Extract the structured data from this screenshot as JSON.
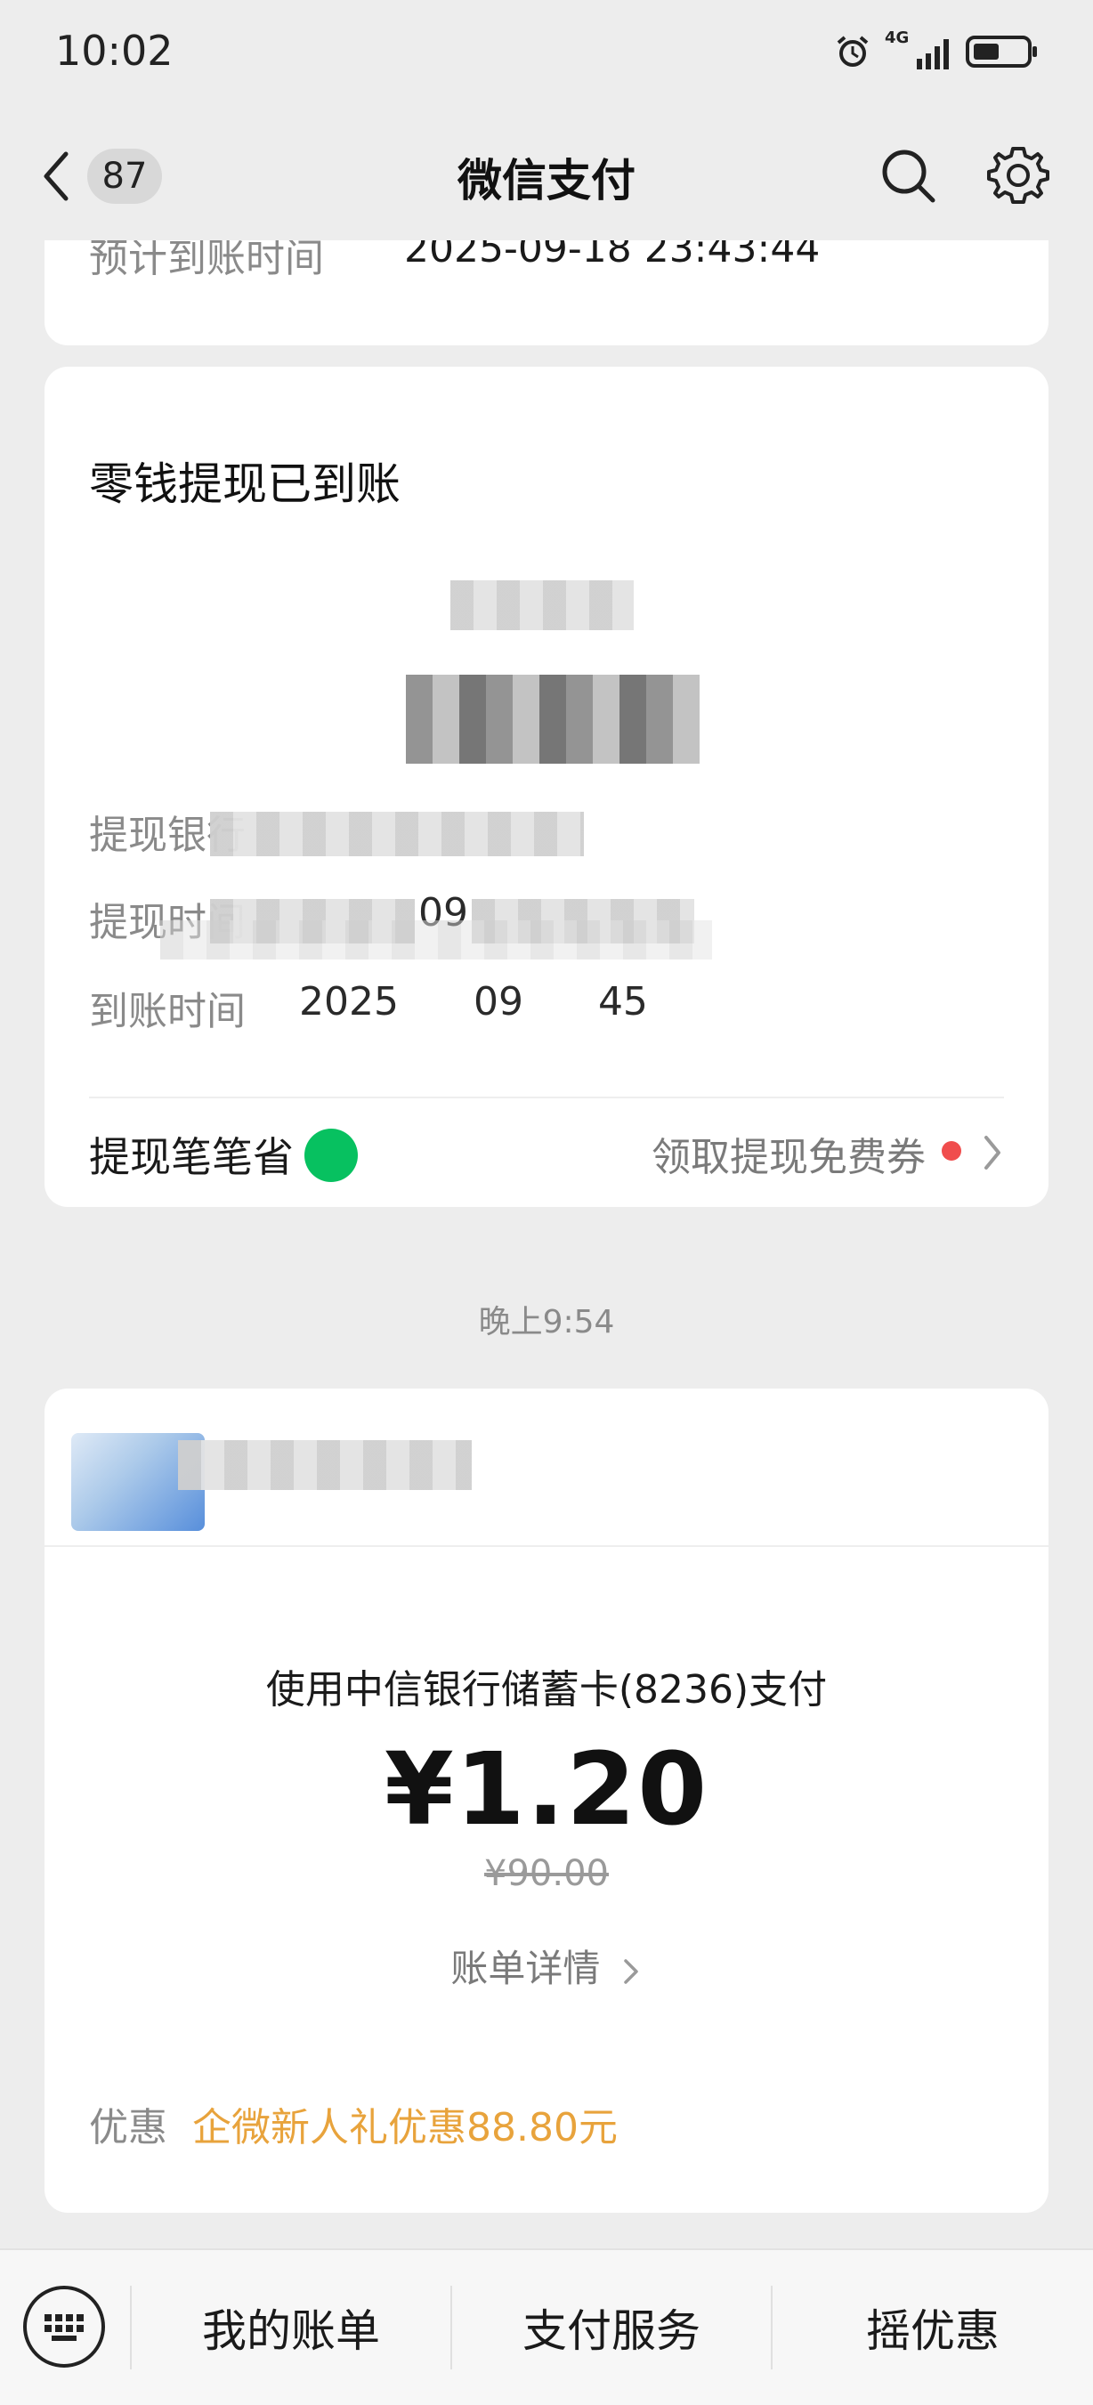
{
  "status_bar": {
    "time": "10:02",
    "network": "4G"
  },
  "nav": {
    "badge": "87",
    "title": "微信支付"
  },
  "card1": {
    "label": "预计到账时间",
    "value": "2025-09-18 23:43:44"
  },
  "card2": {
    "title": "零钱提现已到账",
    "rows": [
      {
        "label": "提现银行",
        "value": ""
      },
      {
        "label": "提现时间",
        "value": "09"
      },
      {
        "label": "到账时间",
        "value": "2025 09 45"
      }
    ],
    "footer_left": "提现笔笔省",
    "footer_right": "领取提现免费券"
  },
  "timestamp": "晚上9:54",
  "card3": {
    "payment_method": "使用中信银行储蓄卡(8236)支付",
    "amount": "¥1.20",
    "original_amount": "¥90.00",
    "detail_link": "账单详情",
    "discount_label": "优惠",
    "discount_value": "企微新人礼优惠88.80元"
  },
  "bottom_bar": {
    "tabs": [
      "我的账单",
      "支付服务",
      "摇优惠"
    ]
  },
  "colors": {
    "accent_green": "#07c160",
    "discount_orange": "#e8a33c",
    "notify_red": "#f04d4d"
  }
}
